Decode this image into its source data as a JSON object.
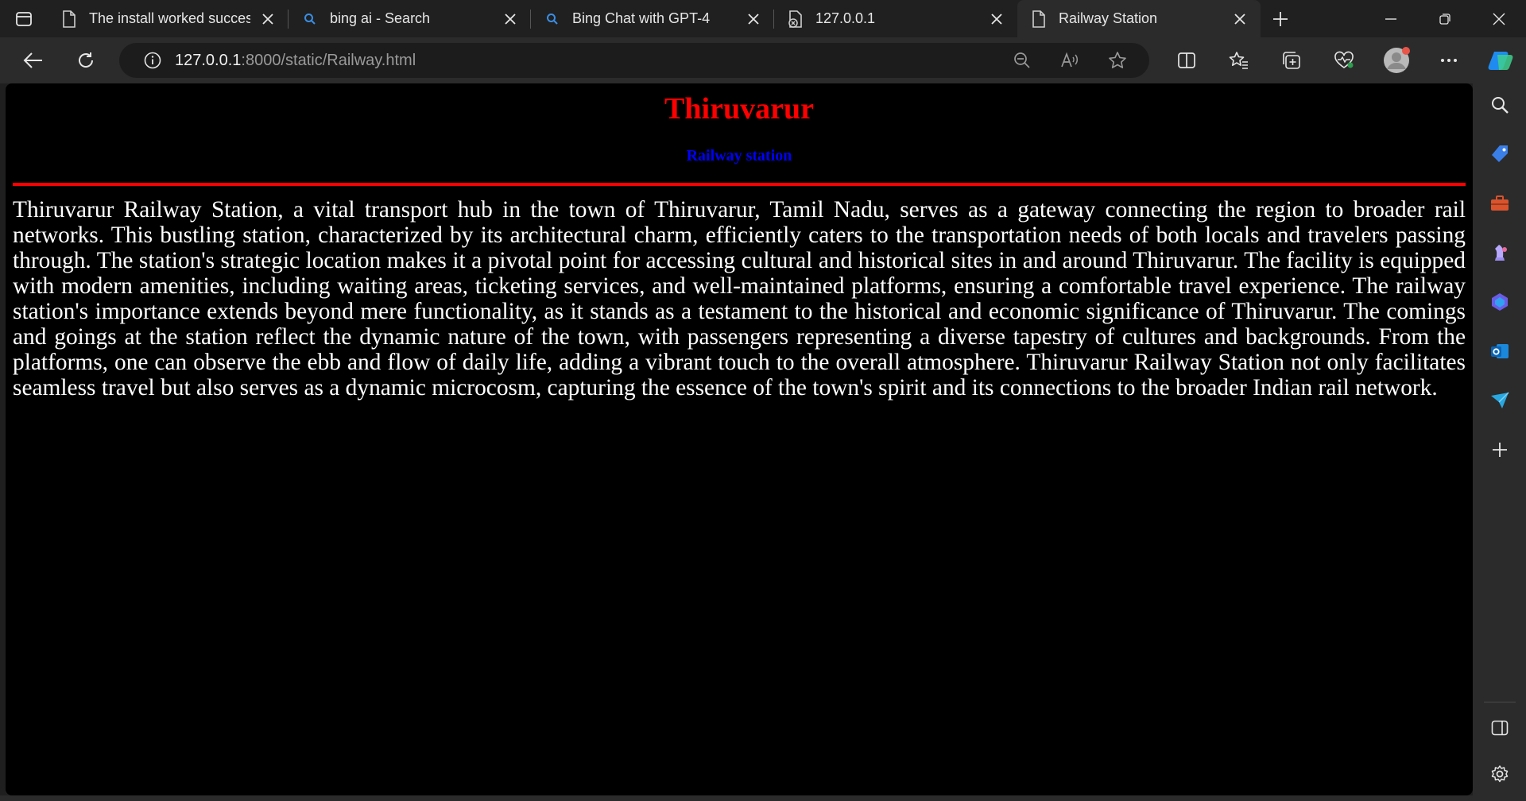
{
  "tabs": [
    {
      "title": "The install worked successfully! Congratulations!",
      "icon": "page-icon"
    },
    {
      "title": "bing ai - Search",
      "icon": "search-icon"
    },
    {
      "title": "Bing Chat with GPT-4",
      "icon": "search-icon"
    },
    {
      "title": "127.0.0.1",
      "icon": "page-error-icon"
    },
    {
      "title": "Railway Station",
      "icon": "page-icon",
      "active": true
    }
  ],
  "address": {
    "host": "127.0.0.1",
    "rest": ":8000/static/Railway.html"
  },
  "page": {
    "heading": "Thiruvarur",
    "subheading": "Railway station",
    "paragraph": "Thiruvarur Railway Station, a vital transport hub in the town of Thiruvarur, Tamil Nadu, serves as a gateway connecting the region to broader rail networks. This bustling station, characterized by its architectural charm, efficiently caters to the transportation needs of both locals and travelers passing through. The station's strategic location makes it a pivotal point for accessing cultural and historical sites in and around Thiruvarur. The facility is equipped with modern amenities, including waiting areas, ticketing services, and well-maintained platforms, ensuring a comfortable travel experience. The railway station's importance extends beyond mere functionality, as it stands as a testament to the historical and economic significance of Thiruvarur. The comings and goings at the station reflect the dynamic nature of the town, with passengers representing a diverse tapestry of cultures and backgrounds. From the platforms, one can observe the ebb and flow of daily life, adding a vibrant touch to the overall atmosphere. Thiruvarur Railway Station not only facilitates seamless travel but also serves as a dynamic microcosm, capturing the essence of the town's spirit and its connections to the broader Indian rail network."
  },
  "colors": {
    "heading": "#ff0000",
    "subheading": "#0000ff",
    "rule": "#ff0000",
    "page_background": "#000000",
    "text": "#ffffff"
  }
}
